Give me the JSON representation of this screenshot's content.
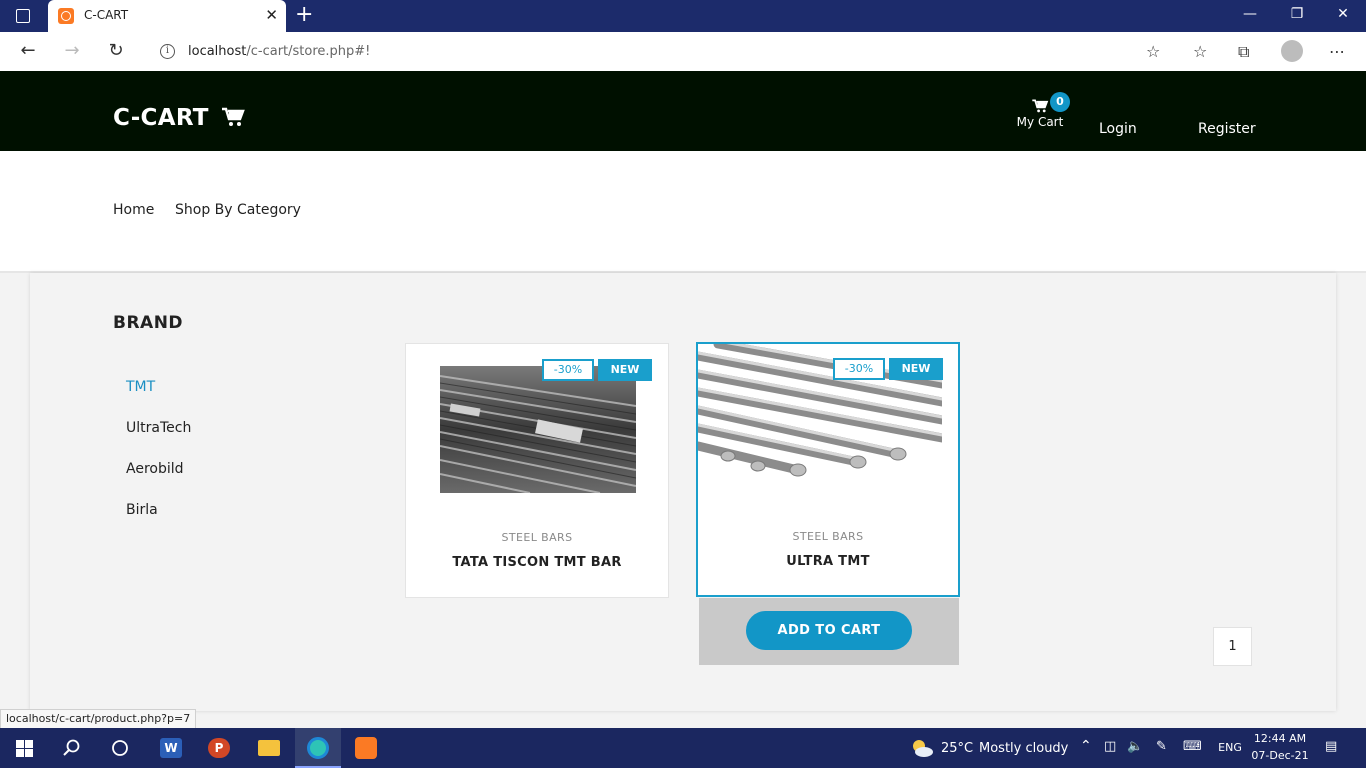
{
  "browser": {
    "tab_title": "C-CART",
    "close_glyph": "✕",
    "new_tab_glyph": "+",
    "window_controls": [
      "—",
      "❐",
      "✕"
    ],
    "url_host": "localhost",
    "url_path": "/c-cart/store.php#!",
    "status_url": "localhost/c-cart/product.php?p=7",
    "icons": [
      "back-icon",
      "forward-icon",
      "refresh-icon",
      "info-icon",
      "favorite-add-icon",
      "favorites-icon",
      "collections-icon",
      "profile-icon",
      "more-icon"
    ]
  },
  "header": {
    "logo_text": "C-CART",
    "cart_label": "My Cart",
    "cart_count": "0",
    "login_label": "Login",
    "register_label": "Register"
  },
  "nav": {
    "home": "Home",
    "shop_by_category": "Shop By Category"
  },
  "sidebar": {
    "title": "BRAND",
    "items": [
      {
        "label": "TMT",
        "active": true
      },
      {
        "label": "UltraTech",
        "active": false
      },
      {
        "label": "Aerobild",
        "active": false
      },
      {
        "label": "Birla",
        "active": false
      }
    ]
  },
  "products": [
    {
      "category": "STEEL BARS",
      "name": "TATA TISCON TMT BAR",
      "sale": "-30%",
      "new": "NEW"
    },
    {
      "category": "STEEL BARS",
      "name": "ULTRA TMT",
      "sale": "-30%",
      "new": "NEW"
    }
  ],
  "add_to_cart_label": "ADD TO CART",
  "pagination": {
    "current": "1"
  },
  "taskbar": {
    "weather_temp": "25°C",
    "weather_text": "Mostly cloudy",
    "language": "ENG",
    "time": "12:44 AM",
    "date": "07-Dec-21"
  },
  "colors": {
    "accent": "#1a9fcc",
    "header_bg": "#001000",
    "titlebar_bg": "#1c2b6b",
    "taskbar_bg": "#1b2760"
  }
}
